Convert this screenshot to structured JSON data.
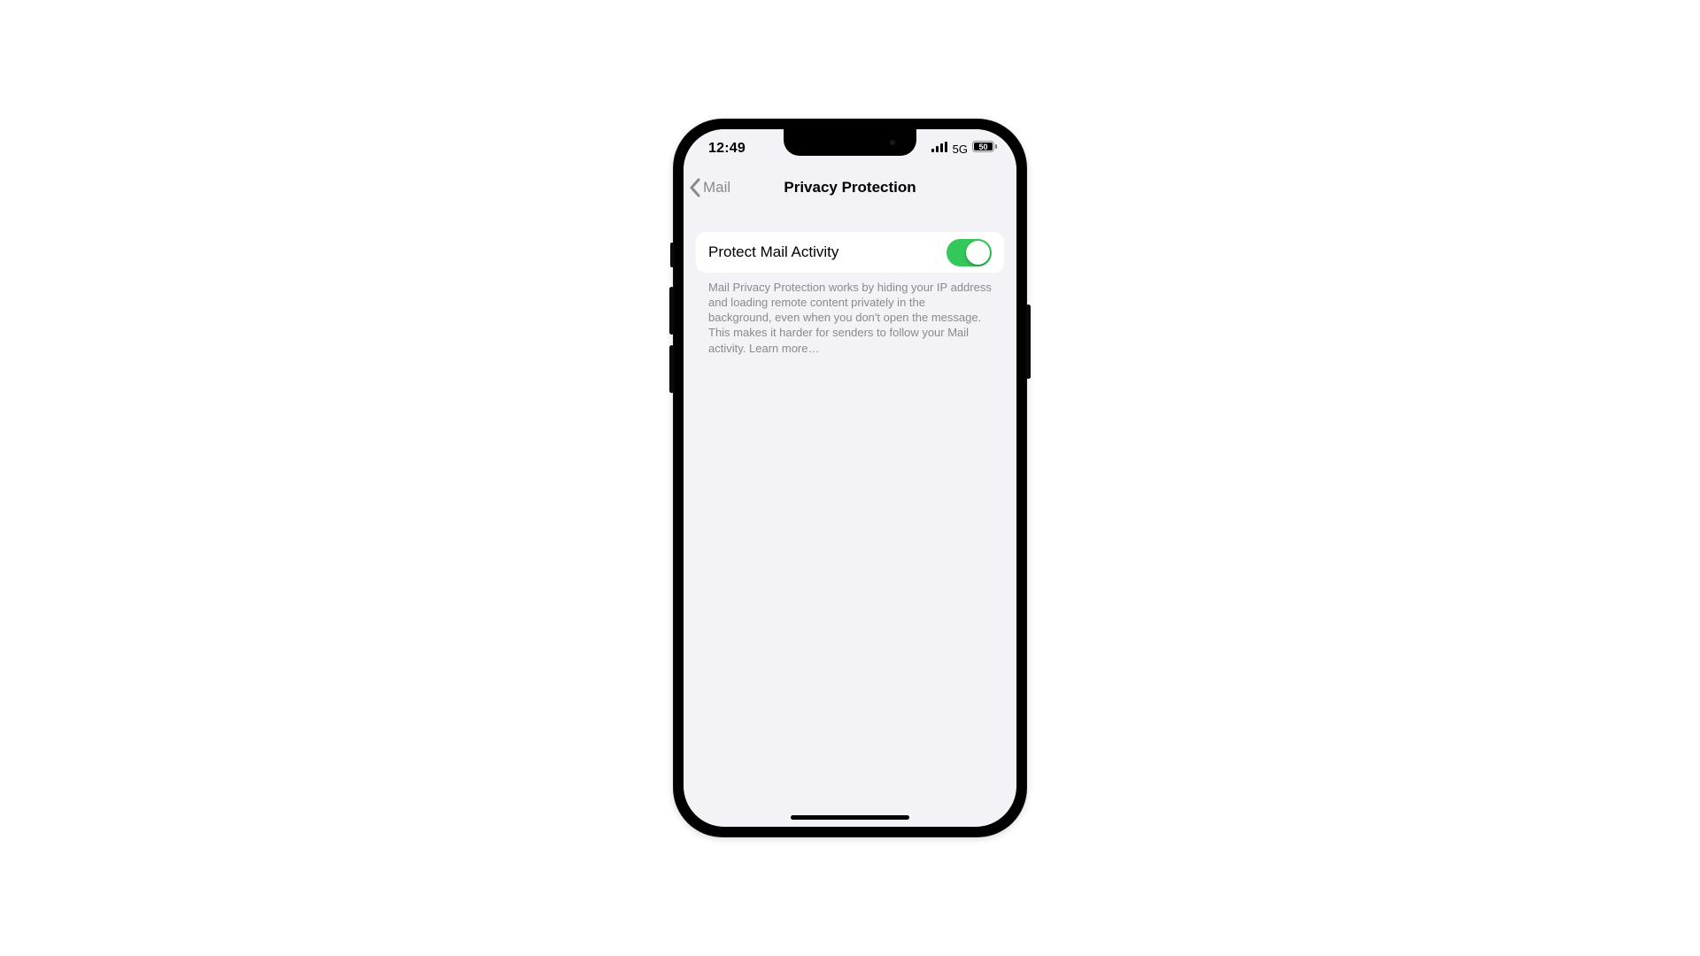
{
  "status_bar": {
    "time": "12:49",
    "carrier_tech": "5G",
    "battery_percent": 50
  },
  "nav": {
    "back_label": "Mail",
    "title": "Privacy Protection"
  },
  "setting": {
    "label": "Protect Mail Activity",
    "enabled": true
  },
  "footer": {
    "text": "Mail Privacy Protection works by hiding your IP address and loading remote content privately in the background, even when you don't open the message. This makes it harder for senders to follow your Mail activity. ",
    "learn_more": "Learn more…"
  }
}
